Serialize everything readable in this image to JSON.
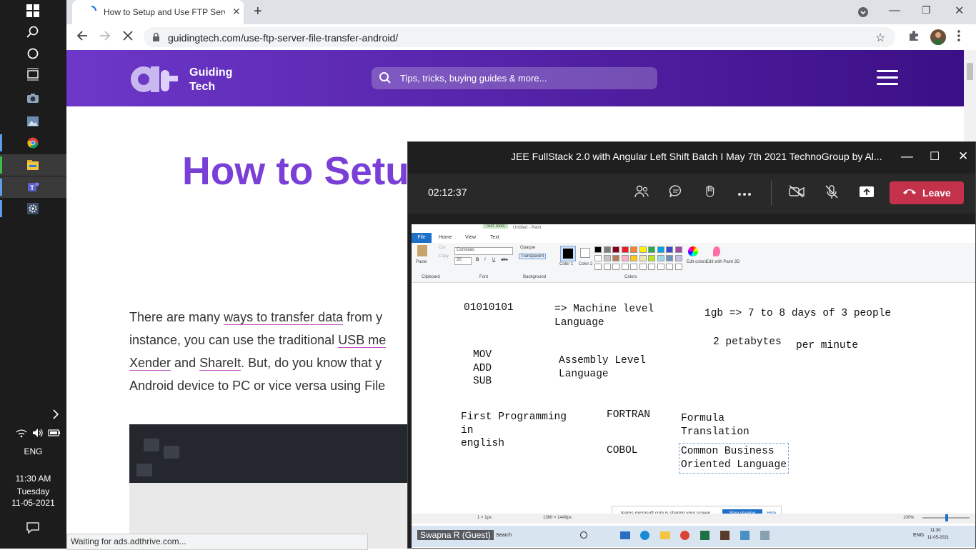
{
  "taskbar": {
    "language": "ENG",
    "time": "11:30 AM",
    "day": "Tuesday",
    "date": "11-05-2021"
  },
  "browser": {
    "tab_title": "How to Setup and Use FTP Serve",
    "url": "guidingtech.com/use-ftp-server-file-transfer-android/",
    "status": "Waiting for ads.adthrive.com..."
  },
  "site": {
    "logo_line1": "Guiding",
    "logo_line2": "Tech",
    "search_placeholder": "Tips, tricks, buying guides & more...",
    "title": "How to Setu",
    "article_lines": [
      {
        "pre": "There are many ",
        "link": "ways to transfer data",
        "post": " from y"
      },
      {
        "pre": "instance, you can use the traditional ",
        "link": "USB me",
        "post": ""
      },
      {
        "link": "Xender",
        "mid": " and ",
        "link2": "ShareIt",
        "post": ". But, do you know that y"
      },
      {
        "pre": "Android device to PC or vice versa using File",
        "link": "",
        "post": ""
      }
    ]
  },
  "teams": {
    "title": "JEE FullStack 2.0 with Angular Left Shift Batch I May 7th 2021 TechnoGroup by Al...",
    "meeting_time": "02:12:37",
    "leave_label": "Leave",
    "presenter_name": "Swapna R (Guest)"
  },
  "paint": {
    "tabs": [
      "File",
      "Home",
      "View",
      "Text"
    ],
    "text_tools_label": "Text Tools",
    "window_title": "Untitled - Paint",
    "font_name": "Consolas",
    "font_size": "20",
    "opaque": "Opaque",
    "transparent": "Transparent",
    "groups": [
      "Clipboard",
      "Font",
      "Background",
      "Colors"
    ],
    "paste": "Paste",
    "cut": "Cut",
    "copy": "Copy",
    "color1": "Color 1",
    "color2": "Color 2",
    "edit_colors": "Edit colors",
    "edit_paint3d": "Edit with Paint 3D",
    "status_size": "1 × 1px",
    "status_canvas": "1360 × 1449px",
    "zoom": "100%",
    "notes": {
      "binary": "01010101",
      "machine": "=> Machine level\nLanguage",
      "storage": "1gb => 7 to 8 days of 3 people",
      "petabytes": "2 petabytes",
      "per_minute": "per minute",
      "mnemonics": "MOV\nADD\nSUB",
      "assembly": "Assembly Level\nLanguage",
      "first_prog": "First Programming\nin\nenglish",
      "fortran": "FORTRAN",
      "formula": "Formula\nTranslation",
      "cobol": "COBOL",
      "cobol_full": "Common Business\nOriented Language"
    },
    "sharing_notice": "teams.microsoft.com is sharing your screen.",
    "stop_sharing": "Stop sharing",
    "hide": "Hide",
    "remote_search": "Search",
    "remote_lang": "ENG",
    "remote_time": "11:30",
    "remote_date": "11-05-2021"
  },
  "colors": {
    "teams_leave": "#c4314b",
    "header_gradient_start": "#6d37c9",
    "header_gradient_end": "#3b0f86",
    "title_purple": "#7a3fd6",
    "link_underline": "#c054c0"
  }
}
